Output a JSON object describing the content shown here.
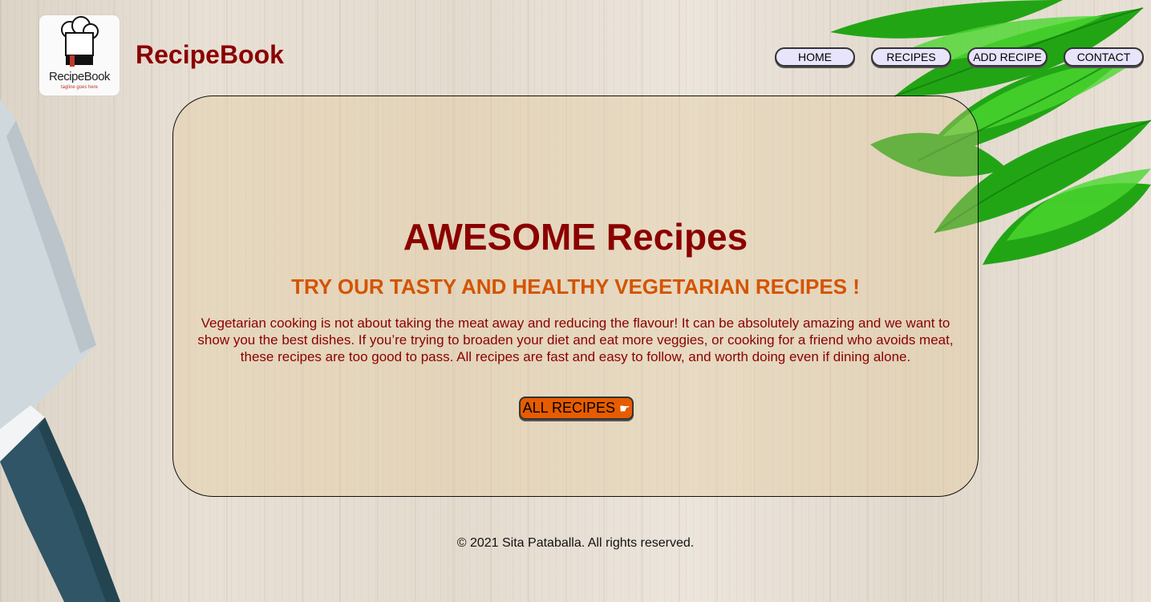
{
  "header": {
    "logo": {
      "text": "RecipeBook",
      "tagline": "tagline goes here"
    },
    "brand": "RecipeBook"
  },
  "nav": {
    "items": [
      {
        "label": "HOME"
      },
      {
        "label": "RECIPES"
      },
      {
        "label": "ADD RECIPE"
      },
      {
        "label": "CONTACT"
      }
    ]
  },
  "hero": {
    "title": "AWESOME Recipes",
    "subtitle": "TRY OUR TASTY AND HEALTHY VEGETARIAN RECIPES !",
    "text": "Vegetarian cooking is not about taking the meat away and reducing the flavour! It can be absolutely amazing and we want to show you the best dishes. If you’re trying to broaden your diet and eat more veggies, or cooking for a friend who avoids meat, these recipes are too good to pass. All recipes are fast and easy to follow, and worth doing even if dining alone.",
    "cta_label": "ALL RECIPES",
    "cta_icon": "pointing-hand-icon"
  },
  "footer": {
    "text": "© 2021 Sita Pataballa. All rights reserved."
  },
  "colors": {
    "brand": "#8b0000",
    "accent": "#d35400",
    "cta_bg": "#e65c00",
    "nav_bg": "#e7e4fb"
  }
}
